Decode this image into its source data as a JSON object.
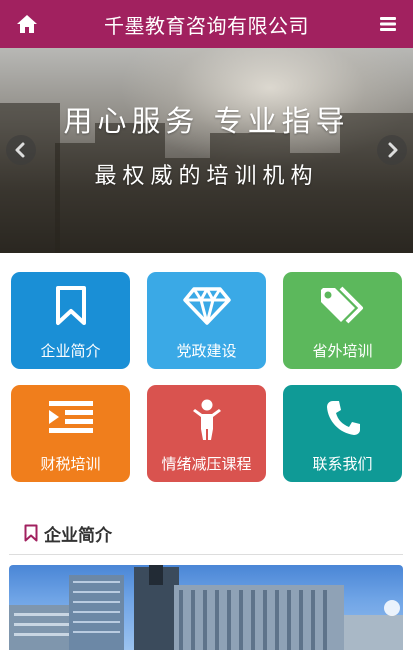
{
  "header": {
    "title": "千墨教育咨询有限公司",
    "home_icon": "home-icon",
    "menu_icon": "menu-icon",
    "bg_color": "#a1215f"
  },
  "banner": {
    "headline": "用心服务 专业指导",
    "subline": "最权威的培训机构",
    "prev_icon": "chevron-left-icon",
    "next_icon": "chevron-right-icon"
  },
  "tiles": [
    {
      "label": "企业简介",
      "icon": "bookmark-icon",
      "color": "#1a8fd6"
    },
    {
      "label": "党政建设",
      "icon": "diamond-icon",
      "color": "#3aa9e6"
    },
    {
      "label": "省外培训",
      "icon": "tags-icon",
      "color": "#5cb85c"
    },
    {
      "label": "财税培训",
      "icon": "indent-icon",
      "color": "#f07e1c"
    },
    {
      "label": "情绪减压课程",
      "icon": "child-icon",
      "color": "#d9534f"
    },
    {
      "label": "联系我们",
      "icon": "phone-icon",
      "color": "#0f9a96"
    }
  ],
  "section": {
    "title": "企业简介",
    "icon": "bookmark-outline-icon",
    "accent": "#a1215f"
  }
}
